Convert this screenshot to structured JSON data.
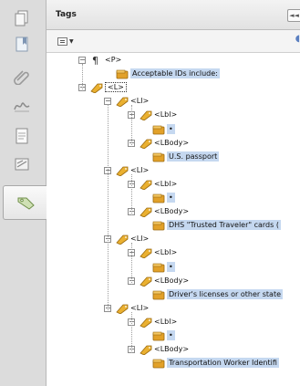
{
  "panel": {
    "title": "Tags",
    "collapse_label": "◄◄"
  },
  "rail": {
    "buttons": [
      {
        "name": "pages-icon"
      },
      {
        "name": "bookmarks-icon"
      },
      {
        "name": "attachments-icon"
      },
      {
        "name": "signatures-icon"
      },
      {
        "name": "content-icon"
      },
      {
        "name": "layers-icon"
      },
      {
        "name": "tags-icon",
        "active": true
      }
    ]
  },
  "tree": [
    {
      "kind": "tag",
      "text": "<P>",
      "level": 1,
      "icon": "paragraph-icon",
      "expanded": true
    },
    {
      "kind": "content",
      "text": "Acceptable IDs include:",
      "level": 2
    },
    {
      "kind": "tag",
      "text": "<L>",
      "level": 1,
      "icon": "tag-icon",
      "expanded": true,
      "selected": true
    },
    {
      "kind": "tag",
      "text": "<LI>",
      "level": 2,
      "icon": "tag-icon",
      "expanded": true
    },
    {
      "kind": "tag",
      "text": "<Lbl>",
      "level": 3,
      "icon": "tag-icon",
      "expanded": true
    },
    {
      "kind": "content",
      "text": "•",
      "level": 4,
      "bullet": true
    },
    {
      "kind": "tag",
      "text": "<LBody>",
      "level": 3,
      "icon": "tag-icon",
      "expanded": true
    },
    {
      "kind": "content",
      "text": "U.S. passport",
      "level": 4
    },
    {
      "kind": "tag",
      "text": "<LI>",
      "level": 2,
      "icon": "tag-icon",
      "expanded": true
    },
    {
      "kind": "tag",
      "text": "<Lbl>",
      "level": 3,
      "icon": "tag-icon",
      "expanded": true
    },
    {
      "kind": "content",
      "text": "•",
      "level": 4,
      "bullet": true
    },
    {
      "kind": "tag",
      "text": "<LBody>",
      "level": 3,
      "icon": "tag-icon",
      "expanded": true
    },
    {
      "kind": "content",
      "text": "DHS \"Trusted Traveler\" cards (",
      "level": 4
    },
    {
      "kind": "tag",
      "text": "<LI>",
      "level": 2,
      "icon": "tag-icon",
      "expanded": true
    },
    {
      "kind": "tag",
      "text": "<Lbl>",
      "level": 3,
      "icon": "tag-icon",
      "expanded": true
    },
    {
      "kind": "content",
      "text": "•",
      "level": 4,
      "bullet": true
    },
    {
      "kind": "tag",
      "text": "<LBody>",
      "level": 3,
      "icon": "tag-icon",
      "expanded": true
    },
    {
      "kind": "content",
      "text": "Driver's licenses or other state",
      "level": 4
    },
    {
      "kind": "tag",
      "text": "<LI>",
      "level": 2,
      "icon": "tag-icon",
      "expanded": true
    },
    {
      "kind": "tag",
      "text": "<Lbl>",
      "level": 3,
      "icon": "tag-icon",
      "expanded": true
    },
    {
      "kind": "content",
      "text": "•",
      "level": 4,
      "bullet": true
    },
    {
      "kind": "tag",
      "text": "<LBody>",
      "level": 3,
      "icon": "tag-icon",
      "expanded": true
    },
    {
      "kind": "content",
      "text": "Transportation Worker Identifi",
      "level": 4
    }
  ],
  "colors": {
    "content_highlight": "#c5d8f0",
    "tag_orange": "#e8a21f",
    "rail_bg": "#dcdcdc"
  }
}
